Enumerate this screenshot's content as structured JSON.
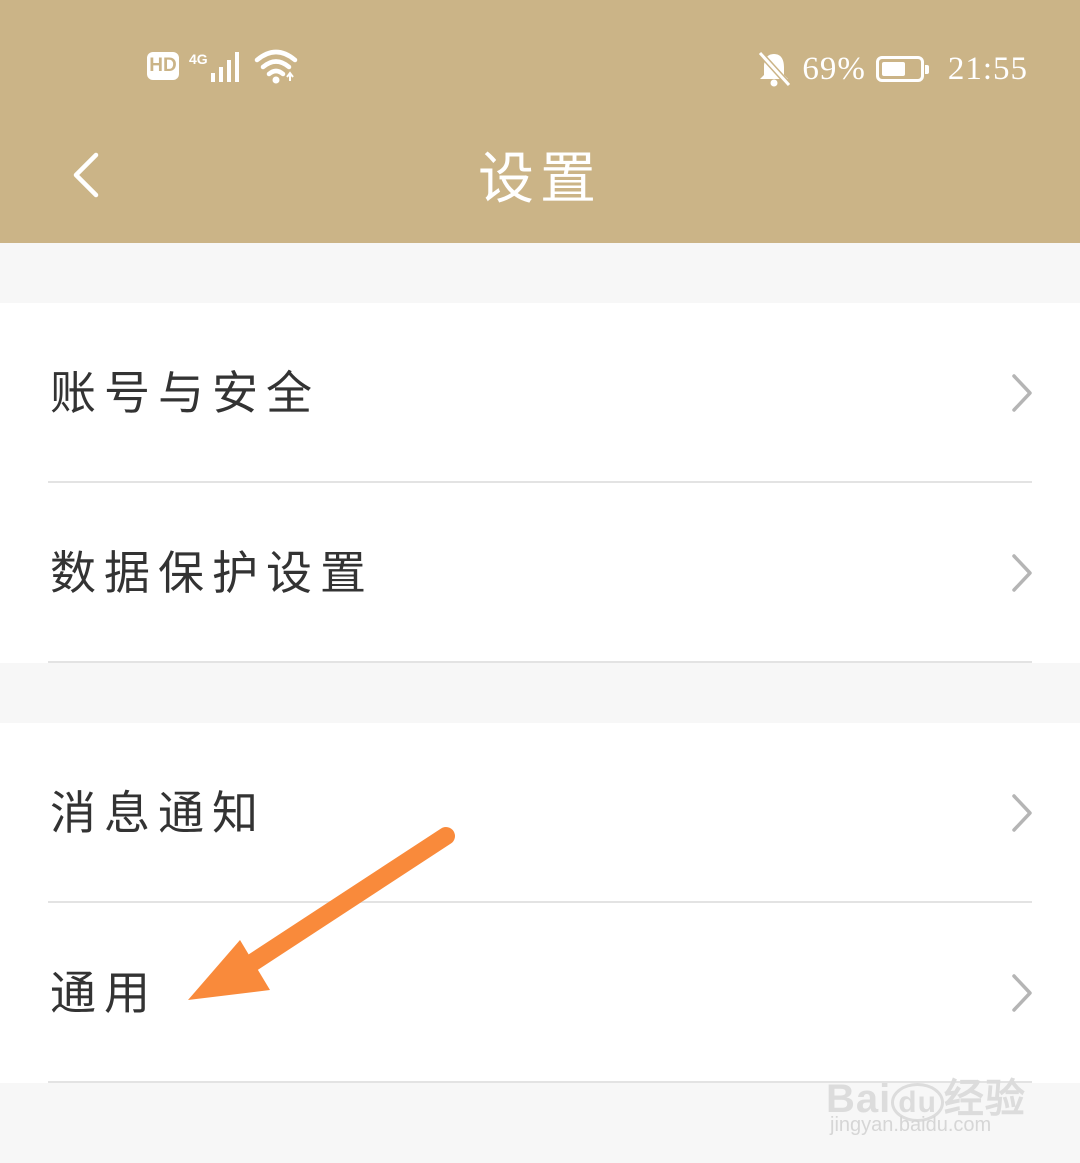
{
  "status_bar": {
    "hd_label": "HD",
    "network_label": "4G",
    "battery_percent": "69%",
    "battery_level": 0.69,
    "time": "21:55",
    "icons": [
      "signal-icon",
      "wifi-icon",
      "bell-off-icon",
      "battery-icon"
    ]
  },
  "header": {
    "title": "设置",
    "back_icon": "chevron-left-icon"
  },
  "sections": [
    {
      "items": [
        {
          "label": "账号与安全"
        },
        {
          "label": "数据保护设置"
        }
      ]
    },
    {
      "items": [
        {
          "label": "消息通知"
        },
        {
          "label": "通用"
        }
      ]
    }
  ],
  "annotation": {
    "arrow_color": "#f98a3b",
    "points_to": "通用"
  },
  "watermark": {
    "logo": "Bai du 经验",
    "url": "jingyan.baidu.com"
  },
  "colors": {
    "header_bg": "#cbb487",
    "page_bg": "#f7f7f7",
    "text": "#333333",
    "chevron": "#b5b5b5"
  }
}
